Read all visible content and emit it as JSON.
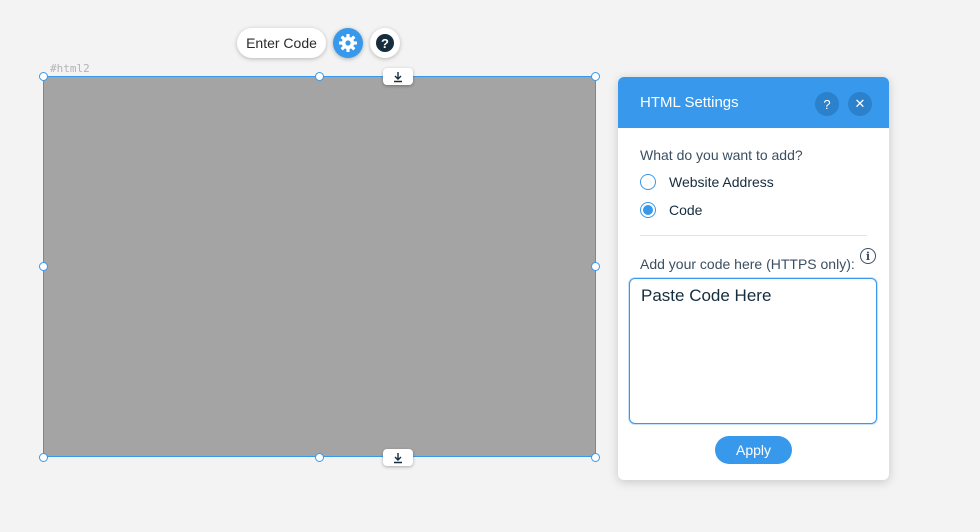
{
  "toolbar": {
    "enter_code_label": "Enter Code",
    "help_glyph": "?"
  },
  "component": {
    "id_label": "#html2"
  },
  "panel": {
    "title": "HTML Settings",
    "help_glyph": "?",
    "close_glyph": "✕",
    "question": "What do you want to add?",
    "options": [
      {
        "label": "Website Address",
        "selected": false
      },
      {
        "label": "Code",
        "selected": true
      }
    ],
    "code_label": "Add your code here (HTTPS only):",
    "info_glyph": "i",
    "code_value": "",
    "code_placeholder": "Paste Code Here",
    "apply_label": "Apply"
  },
  "icons": [
    "gear-icon",
    "help-icon",
    "stretch-icon",
    "info-icon",
    "close-icon"
  ],
  "colors": {
    "accent": "#3899ec",
    "accent_dark": "#2b81cb",
    "placeholder_fill": "#a4a4a4",
    "text_dark": "#162d3d",
    "canvas_bg": "#f3f3f3"
  }
}
